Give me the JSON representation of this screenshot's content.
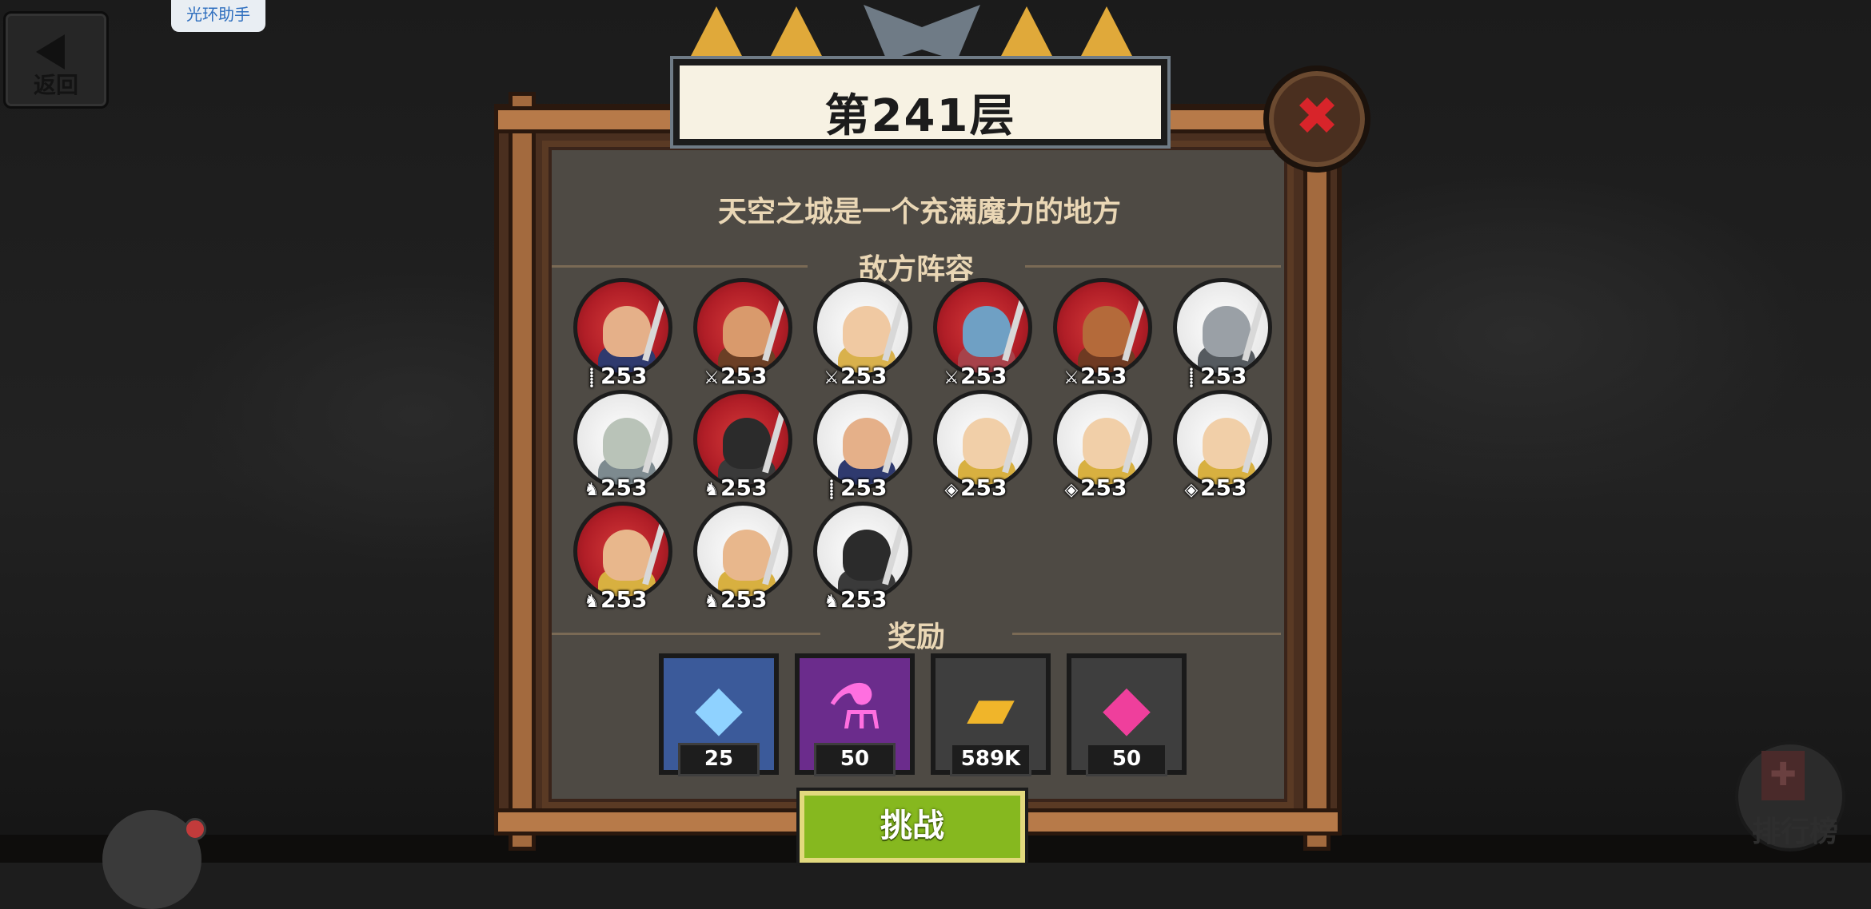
{
  "helper_label": "光环助手",
  "back_label": "返回",
  "title": "第241层",
  "close_label": "✖",
  "subtitle": "天空之城是一个充满魔力的地方",
  "enemy_section": "敌方阵容",
  "rewards_section": "奖励",
  "challenge_label": "挑战",
  "rank_label": "排行榜",
  "enemies": [
    {
      "level": "253",
      "class_icon": "spear-icon",
      "class_glyph": "⸽",
      "style": "red",
      "skin": "#e5b089",
      "armor": "#2f3a6e"
    },
    {
      "level": "253",
      "class_icon": "sword-icon",
      "class_glyph": "⚔",
      "style": "red",
      "skin": "#d99a6c",
      "armor": "#6b3f25"
    },
    {
      "level": "253",
      "class_icon": "sword-icon",
      "class_glyph": "⚔",
      "style": "white",
      "skin": "#f0c9a2",
      "armor": "#d9b14c"
    },
    {
      "level": "253",
      "class_icon": "sword-icon",
      "class_glyph": "⚔",
      "style": "red",
      "skin": "#6fa0c4",
      "armor": "#a7424a"
    },
    {
      "level": "253",
      "class_icon": "sword-icon",
      "class_glyph": "⚔",
      "style": "red",
      "skin": "#b46a3a",
      "armor": "#6e3a22"
    },
    {
      "level": "253",
      "class_icon": "spear-icon",
      "class_glyph": "⸽",
      "style": "white",
      "skin": "#9aa0a6",
      "armor": "#555a5f"
    },
    {
      "level": "253",
      "class_icon": "cavalry-icon",
      "class_glyph": "♞",
      "style": "white",
      "skin": "#b9c3b8",
      "armor": "#7d8a8f"
    },
    {
      "level": "253",
      "class_icon": "cavalry-icon",
      "class_glyph": "♞",
      "style": "red",
      "skin": "#2b2b2b",
      "armor": "#3a3a3a"
    },
    {
      "level": "253",
      "class_icon": "spear-icon",
      "class_glyph": "⸽",
      "style": "white",
      "skin": "#e5b089",
      "armor": "#2f3a6e"
    },
    {
      "level": "253",
      "class_icon": "archer-icon",
      "class_glyph": "◈",
      "style": "white",
      "skin": "#f1cfa8",
      "armor": "#d8b040"
    },
    {
      "level": "253",
      "class_icon": "archer-icon",
      "class_glyph": "◈",
      "style": "white",
      "skin": "#f1cfa8",
      "armor": "#d8b040"
    },
    {
      "level": "253",
      "class_icon": "archer-icon",
      "class_glyph": "◈",
      "style": "white",
      "skin": "#f1cfa8",
      "armor": "#d8b040"
    },
    {
      "level": "253",
      "class_icon": "cavalry-icon",
      "class_glyph": "♞",
      "style": "red",
      "skin": "#e8b78c",
      "armor": "#d8b040"
    },
    {
      "level": "253",
      "class_icon": "cavalry-icon",
      "class_glyph": "♞",
      "style": "white",
      "skin": "#e8b78c",
      "armor": "#d8b040"
    },
    {
      "level": "253",
      "class_icon": "cavalry-icon",
      "class_glyph": "♞",
      "style": "white",
      "skin": "#2b2b2b",
      "armor": "#3a3a3a"
    }
  ],
  "rewards": [
    {
      "icon": "diamond-ore-icon",
      "glyph": "◆",
      "qty": "25",
      "bg": "#3b5a9a",
      "color": "#8fd2ff"
    },
    {
      "icon": "potion-flask-icon",
      "glyph": "⚗",
      "qty": "50",
      "bg": "#6b2c8c",
      "color": "#ff6fe0"
    },
    {
      "icon": "gold-bars-icon",
      "glyph": "▰",
      "qty": "589K",
      "bg": "#3e3e3e",
      "color": "#f0b52a"
    },
    {
      "icon": "pink-gem-icon",
      "glyph": "◆",
      "qty": "50",
      "bg": "#3e3e3e",
      "color": "#ef3f9c"
    }
  ],
  "colors": {
    "accent_red": "#b11e27",
    "challenge_green": "#86b81f",
    "title_text": "#1c1c1c",
    "wood": "#4a2f1f"
  }
}
